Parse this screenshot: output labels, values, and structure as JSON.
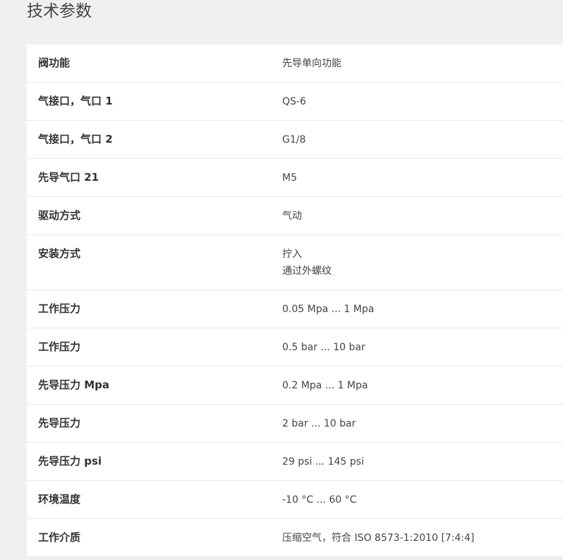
{
  "page": {
    "title": "技术参数"
  },
  "specs": [
    {
      "label": "阀功能",
      "value": "先导单向功能"
    },
    {
      "label": "气接口，气口 1",
      "value": "QS-6"
    },
    {
      "label": "气接口，气口 2",
      "value": "G1/8"
    },
    {
      "label": "先导气口 21",
      "value": "M5"
    },
    {
      "label": "驱动方式",
      "value": "气动"
    },
    {
      "label": "安装方式",
      "value": "拧入",
      "value2": "通过外螺纹"
    },
    {
      "label": "工作压力",
      "value": "0.05 Mpa ... 1 Mpa"
    },
    {
      "label": "工作压力",
      "value": "0.5 bar ... 10 bar"
    },
    {
      "label": "先导压力 Mpa",
      "value": "0.2 Mpa ... 1 Mpa"
    },
    {
      "label": "先导压力",
      "value": "2 bar ... 10 bar"
    },
    {
      "label": "先导压力 psi",
      "value": "29 psi ... 145 psi"
    },
    {
      "label": "环境温度",
      "value": "-10 °C ... 60 °C"
    },
    {
      "label": "工作介质",
      "value": "压缩空气，符合 ISO 8573-1:2010 [7:4:4]"
    }
  ]
}
